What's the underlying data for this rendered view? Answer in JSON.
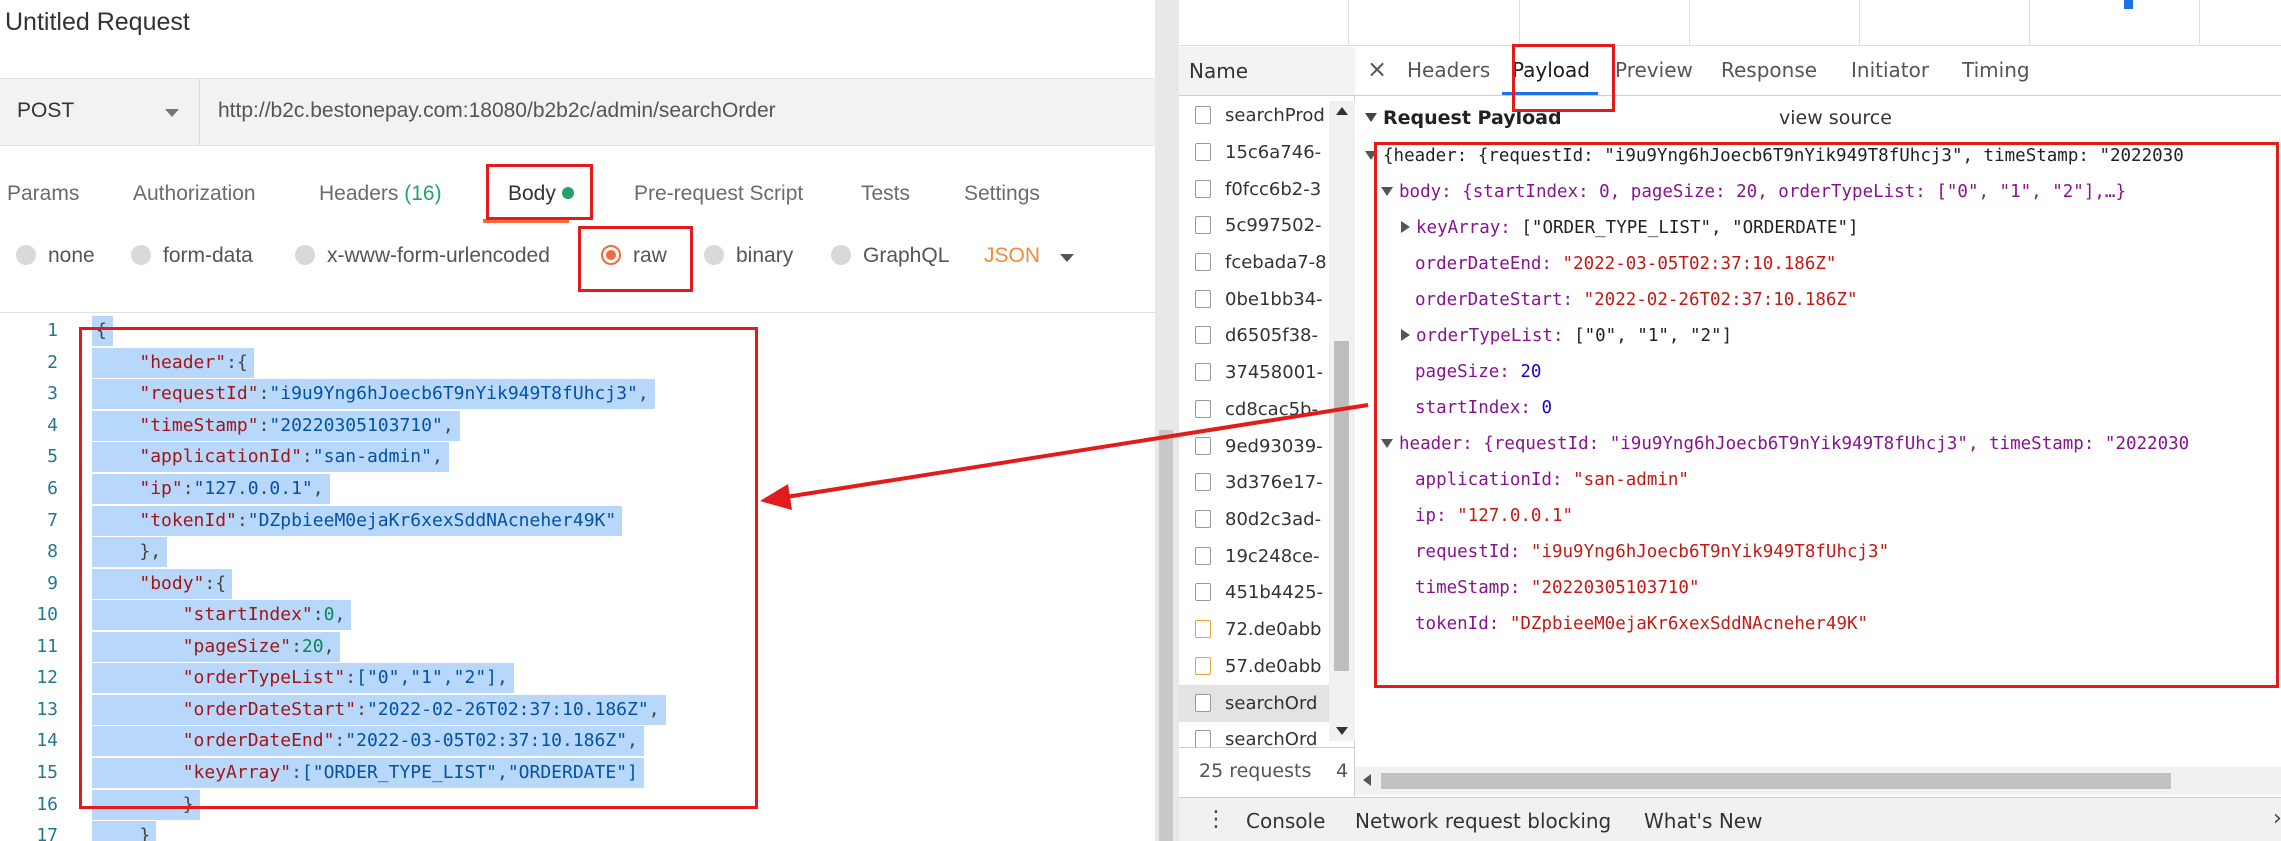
{
  "postman": {
    "request_title": "Untitled Request",
    "method": "POST",
    "url": "http://b2c.bestonepay.com:18080/b2b2c/admin/searchOrder",
    "tabs": {
      "params": "Params",
      "authorization": "Authorization",
      "headers": "Headers",
      "headers_count": "(16)",
      "body": "Body",
      "prerequest": "Pre-request Script",
      "tests": "Tests",
      "settings": "Settings"
    },
    "body_types": {
      "none": "none",
      "form_data": "form-data",
      "urlencoded": "x-www-form-urlencoded",
      "raw": "raw",
      "binary": "binary",
      "graphql": "GraphQL",
      "format": "JSON"
    },
    "line_numbers": [
      "1",
      "2",
      "3",
      "4",
      "5",
      "6",
      "7",
      "8",
      "9",
      "10",
      "11",
      "12",
      "13",
      "14",
      "15",
      "16",
      "17"
    ],
    "code": {
      "l1": "{",
      "l2k": "\"header\"",
      "l2p": ":{",
      "l3k": "\"requestId\"",
      "l3v": "\"i9u9Yng6hJoecb6T9nYik949T8fUhcj3\"",
      "l4k": "\"timeStamp\"",
      "l4v": "\"20220305103710\"",
      "l5k": "\"applicationId\"",
      "l5v": "\"san-admin\"",
      "l6k": "\"ip\"",
      "l6v": "\"127.0.0.1\"",
      "l7k": "\"tokenId\"",
      "l7v": "\"DZpbieeM0ejaKr6xexSddNAcneher49K\"",
      "l8": "},",
      "l9k": "\"body\"",
      "l9p": ":{",
      "l10k": "\"startIndex\"",
      "l10v": "0",
      "l11k": "\"pageSize\"",
      "l11v": "20",
      "l12k": "\"orderTypeList\"",
      "l12v": "[\"0\",\"1\",\"2\"]",
      "l13k": "\"orderDateStart\"",
      "l13v": "\"2022-02-26T02:37:10.186Z\"",
      "l14k": "\"orderDateEnd\"",
      "l14v": "\"2022-03-05T02:37:10.186Z\"",
      "l15k": "\"keyArray\"",
      "l15v": "[\"ORDER_TYPE_LIST\",\"ORDERDATE\"]",
      "l16": "}",
      "l17": "}"
    }
  },
  "devtools": {
    "name_header": "Name",
    "requests": [
      "searchProd",
      "15c6a746-",
      "f0fcc6b2-3",
      "5c997502-",
      "fcebada7-8",
      "0be1bb34-",
      "d6505f38-",
      "37458001-",
      "cd8cac5b-",
      "9ed93039-",
      "3d376e17-",
      "80d2c3ad-",
      "19c248ce-",
      "451b4425-",
      "72.de0abb",
      "57.de0abb",
      "searchOrd",
      "searchOrd"
    ],
    "summary": "25 requests",
    "summary_extra": "4",
    "tabs": {
      "close": "×",
      "headers": "Headers",
      "payload": "Payload",
      "preview": "Preview",
      "response": "Response",
      "initiator": "Initiator",
      "timing": "Timing"
    },
    "payload_title": "Request Payload",
    "view_source": "view source",
    "tree": {
      "root": "{header: {requestId: \"i9u9Yng6hJoecb6T9nYik949T8fUhcj3\", timeStamp: \"2022030",
      "body_summary": "body: {startIndex: 0, pageSize: 20, orderTypeList: [\"0\", \"1\", \"2\"],…}",
      "keyArray_k": "keyArray:",
      "keyArray_v": "[\"ORDER_TYPE_LIST\", \"ORDERDATE\"]",
      "orderDateEnd_k": "orderDateEnd:",
      "orderDateEnd_v": "\"2022-03-05T02:37:10.186Z\"",
      "orderDateStart_k": "orderDateStart:",
      "orderDateStart_v": "\"2022-02-26T02:37:10.186Z\"",
      "orderTypeList_k": "orderTypeList:",
      "orderTypeList_v": "[\"0\", \"1\", \"2\"]",
      "pageSize_k": "pageSize:",
      "pageSize_v": "20",
      "startIndex_k": "startIndex:",
      "startIndex_v": "0",
      "header_summary": "header: {requestId: \"i9u9Yng6hJoecb6T9nYik949T8fUhcj3\", timeStamp: \"2022030",
      "applicationId_k": "applicationId:",
      "applicationId_v": "\"san-admin\"",
      "ip_k": "ip:",
      "ip_v": "\"127.0.0.1\"",
      "requestId_k": "requestId:",
      "requestId_v": "\"i9u9Yng6hJoecb6T9nYik949T8fUhcj3\"",
      "timeStamp_k": "timeStamp:",
      "timeStamp_v": "\"20220305103710\"",
      "tokenId_k": "tokenId:",
      "tokenId_v": "\"DZpbieeM0ejaKr6xexSddNAcneher49K\""
    },
    "drawer": {
      "console": "Console",
      "blocking": "Network request blocking",
      "whats_new": "What's New"
    }
  },
  "colors": {
    "annotation": "#e31b1b",
    "postman_accent": "#f26b3a",
    "devtools_accent": "#1a73e8",
    "selection": "#b7d8fb"
  }
}
